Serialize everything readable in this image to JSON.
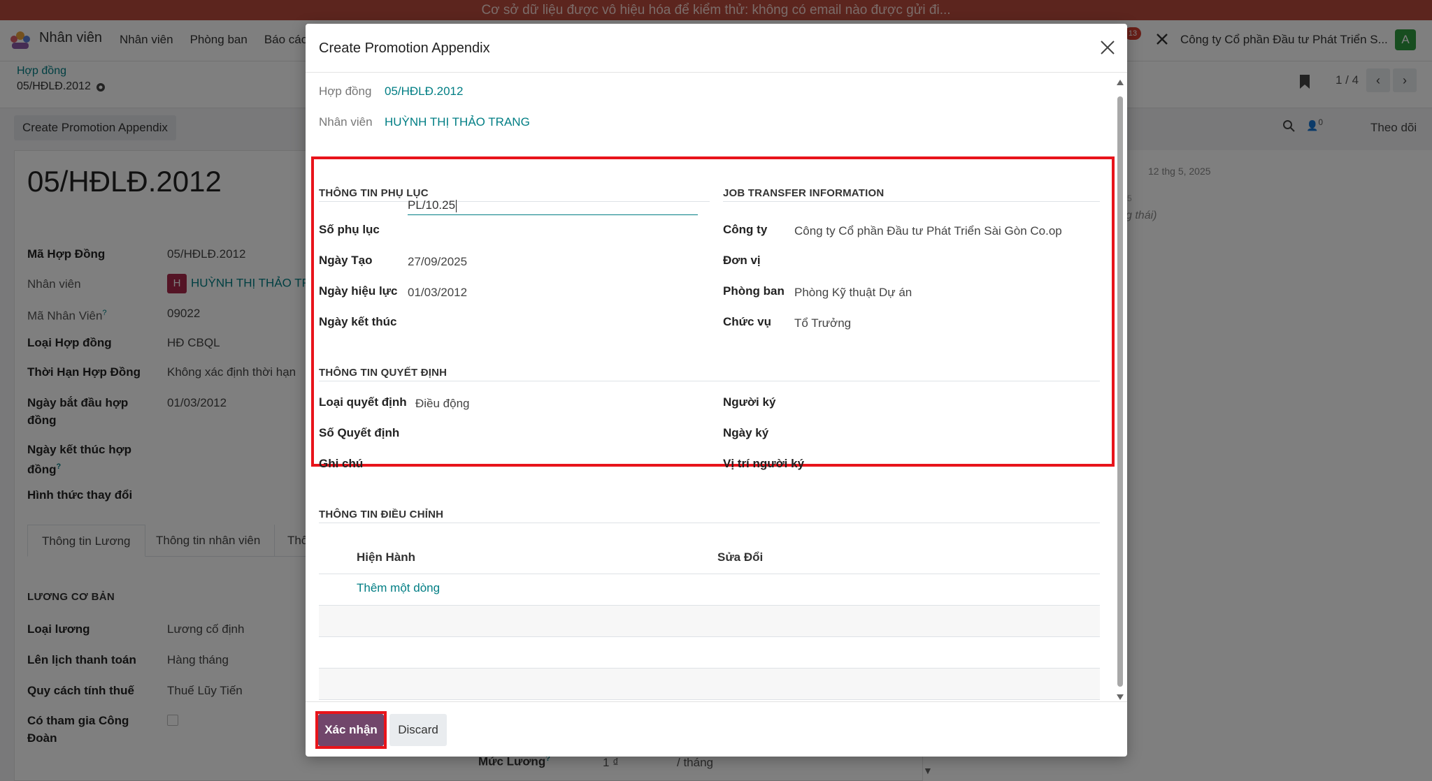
{
  "banner": "Cơ sở dữ liệu được vô hiệu hóa để kiểm thử: không có email nào được gửi đi...",
  "topnav": {
    "app_name": "Nhân viên",
    "menu": [
      "Nhân viên",
      "Phòng ban",
      "Báo cáo"
    ],
    "notification_count": "13",
    "company": "Công ty Cổ phần Đầu tư Phát Triển S...",
    "avatar_letter": "A"
  },
  "breadcrumb": {
    "parent": "Hợp đồng",
    "current": "05/HĐLĐ.2012"
  },
  "pager": {
    "text": "1 / 4",
    "prev": "‹",
    "next": "›"
  },
  "actionbar": {
    "button": "Create Promotion Appendix",
    "follower_count": "0",
    "follow": "Theo dõi"
  },
  "record": {
    "title": "05/HĐLĐ.2012",
    "fields": [
      {
        "label": "Mã Hợp Đồng",
        "value": "05/HĐLĐ.2012"
      },
      {
        "label": "Nhân viên",
        "value": "HUỲNH THỊ THẢO TRA",
        "badge": "H"
      },
      {
        "label": "Mã Nhân Viên",
        "value": "09022",
        "help": "?"
      },
      {
        "label": "Loại Hợp đồng",
        "value": "HĐ CBQL"
      },
      {
        "label": "Thời Hạn Hợp Đồng",
        "value": "Không xác định thời hạn"
      },
      {
        "label": "Ngày bắt đầu hợp đồng",
        "value": "01/03/2012"
      },
      {
        "label": "Ngày kết thúc hợp đồng",
        "value": "",
        "help": "?"
      },
      {
        "label": "Hình thức thay đổi",
        "value": ""
      }
    ],
    "tabs": [
      "Thông tin Lương",
      "Thông tin nhân viên",
      "Thô"
    ],
    "salary_section": "LƯƠNG CƠ BẢN",
    "salary_fields": [
      {
        "label": "Loại lương",
        "value": "Lương cố định"
      },
      {
        "label": "Lên lịch thanh toán",
        "value": "Hàng tháng"
      },
      {
        "label": "Quy cách tính thuế",
        "value": "Thuế Lũy Tiến"
      },
      {
        "label": "Có tham gia Công Đoàn",
        "value": ""
      }
    ],
    "salary_rate": {
      "label": "Mức Lương",
      "help": "?",
      "amount": "1 ₫",
      "unit": "/ tháng"
    }
  },
  "chatter": {
    "date": "12 thg 5, 2025",
    "ghost1": "5",
    "ghost2": "g thái)"
  },
  "modal": {
    "title": "Create Promotion Appendix",
    "contract": {
      "label": "Hợp đồng",
      "value": "05/HĐLĐ.2012"
    },
    "employee": {
      "label": "Nhân viên",
      "value": "HUỲNH THỊ THẢO TRANG"
    },
    "appendix_section": "THÔNG TIN PHỤ LỤC",
    "appendix_fields": [
      {
        "label": "Số phụ lục",
        "value": "PL/10.25"
      },
      {
        "label": "Ngày Tạo",
        "value": "27/09/2025"
      },
      {
        "label": "Ngày hiệu lực",
        "value": "01/03/2012"
      },
      {
        "label": "Ngày kết thúc",
        "value": ""
      }
    ],
    "transfer_section": "JOB TRANSFER INFORMATION",
    "transfer_fields": [
      {
        "label": "Công ty",
        "value": "Công ty Cổ phần Đầu tư Phát Triển Sài Gòn Co.op"
      },
      {
        "label": "Đơn vị",
        "value": ""
      },
      {
        "label": "Phòng ban",
        "value": "Phòng Kỹ thuật Dự án"
      },
      {
        "label": "Chức vụ",
        "value": "Tổ Trưởng"
      }
    ],
    "decision_section": "THÔNG TIN QUYẾT ĐỊNH",
    "decision_left": [
      {
        "label": "Loại quyết định",
        "value": "Điều động"
      },
      {
        "label": "Số Quyết định",
        "value": ""
      },
      {
        "label": "Ghi chú",
        "value": ""
      }
    ],
    "decision_right": [
      {
        "label": "Người ký",
        "value": ""
      },
      {
        "label": "Ngày ký",
        "value": ""
      },
      {
        "label": "Vị trí người ký",
        "value": ""
      }
    ],
    "adjust_section": "THÔNG TIN ĐIỀU CHỈNH",
    "adjust_columns": [
      "Hiện Hành",
      "Sửa Đổi"
    ],
    "add_line": "Thêm một dòng",
    "confirm": "Xác nhận",
    "discard": "Discard"
  },
  "colors": {
    "accent": "#017e84",
    "primary": "#71466b",
    "highlight": "#e8141b",
    "banner": "#b94a3d"
  }
}
